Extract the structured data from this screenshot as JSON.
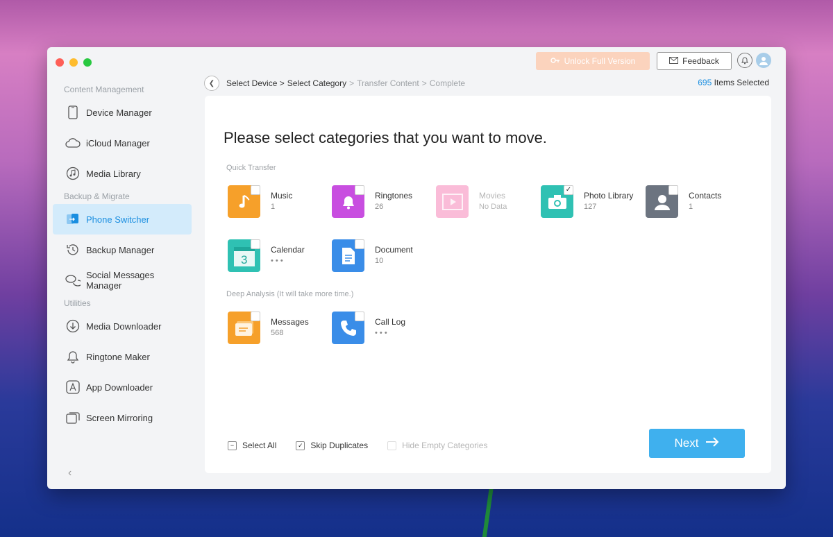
{
  "topbar": {
    "unlock_label": "Unlock Full Version",
    "feedback_label": "Feedback"
  },
  "sidebar": {
    "sections": [
      {
        "title": "Content Management",
        "items": [
          {
            "label": "Device Manager",
            "icon": "phone-icon"
          },
          {
            "label": "iCloud Manager",
            "icon": "cloud-icon"
          },
          {
            "label": "Media Library",
            "icon": "music-disc-icon"
          }
        ]
      },
      {
        "title": "Backup & Migrate",
        "items": [
          {
            "label": "Phone Switcher",
            "icon": "phone-switch-icon",
            "active": true
          },
          {
            "label": "Backup Manager",
            "icon": "history-icon"
          },
          {
            "label": "Social Messages Manager",
            "icon": "chat-bubbles-icon"
          }
        ]
      },
      {
        "title": "Utilities",
        "items": [
          {
            "label": "Media Downloader",
            "icon": "download-circle-icon"
          },
          {
            "label": "Ringtone Maker",
            "icon": "bell-icon"
          },
          {
            "label": "App Downloader",
            "icon": "app-store-icon"
          },
          {
            "label": "Screen Mirroring",
            "icon": "screens-icon"
          }
        ]
      }
    ]
  },
  "breadcrumb": {
    "steps": [
      "Select Device >",
      "Select Category",
      ">",
      "Transfer Content",
      ">",
      "Complete"
    ]
  },
  "selection": {
    "count": "695",
    "suffix": " Items Selected"
  },
  "main": {
    "headline": "Please select categories that you want to move.",
    "quick_label": "Quick Transfer",
    "deep_label": "Deep Analysis (It will take more time.)",
    "quick_items": [
      {
        "name": "Music",
        "count": "1",
        "color": "#f6a02a",
        "icon": "music-note-icon",
        "checked": false
      },
      {
        "name": "Ringtones",
        "count": "26",
        "color": "#c84ee0",
        "icon": "bell-icon",
        "checked": false
      },
      {
        "name": "Movies",
        "count": "No Data",
        "color": "#f36aa8",
        "icon": "film-icon",
        "disabled": true
      },
      {
        "name": "Photo Library",
        "count": "127",
        "color": "#2fc1b3",
        "icon": "camera-icon",
        "checked": true
      },
      {
        "name": "Contacts",
        "count": "1",
        "color": "#6c7480",
        "icon": "person-icon",
        "checked": false
      },
      {
        "name": "Calendar",
        "count": "• • •",
        "color": "#2fc1b3",
        "icon": "calendar-icon",
        "checked": false
      },
      {
        "name": "Document",
        "count": "10",
        "color": "#3a8de8",
        "icon": "document-icon",
        "checked": false
      }
    ],
    "deep_items": [
      {
        "name": "Messages",
        "count": "568",
        "color": "#f6a02a",
        "icon": "message-icon",
        "checked": false
      },
      {
        "name": "Call Log",
        "count": "• • •",
        "color": "#3a8de8",
        "icon": "phone-call-icon",
        "checked": false
      }
    ]
  },
  "footer": {
    "select_all": "Select All",
    "skip_duplicates": "Skip Duplicates",
    "hide_empty": "Hide Empty Categories",
    "next_label": "Next"
  }
}
